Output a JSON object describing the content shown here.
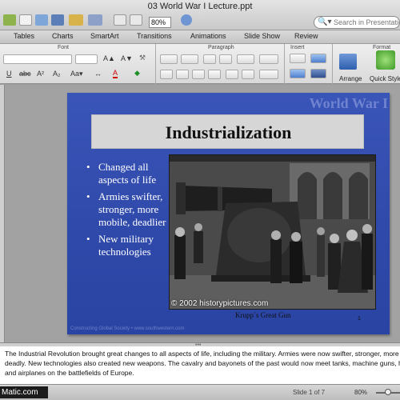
{
  "window": {
    "title": "03 World War I Lecture.ppt"
  },
  "toolbar": {
    "zoom": "80%",
    "search_placeholder": "Search in Presentation"
  },
  "ribbon": {
    "tabs": [
      {
        "label": "Tables"
      },
      {
        "label": "Charts"
      },
      {
        "label": "SmartArt"
      },
      {
        "label": "Transitions"
      },
      {
        "label": "Animations"
      },
      {
        "label": "Slide Show"
      },
      {
        "label": "Review"
      }
    ],
    "groups": {
      "font": "Font",
      "paragraph": "Paragraph",
      "insert": "Insert",
      "format": "Format"
    },
    "arrange_label": "Arrange",
    "quick_styles_label": "Quick Styles"
  },
  "slide": {
    "header": "World War I",
    "title": "Industrialization",
    "bullets": [
      "Changed all aspects of life",
      "Armies swifter, stronger, more mobile, deadlier",
      "New military technologies"
    ],
    "picture_caption": "© 2002 historypictures.com",
    "krupp_caption": "Krupp´s Great Gun",
    "slide_number": "1",
    "footer": "Constructing Global Society • www.southwestern.com"
  },
  "notes": {
    "lines": [
      "The Industrial Revolution brought great changes to all aspects of life, including the military. Armies were now swifter, stronger, more m",
      "deadly. New technologies also created new weapons. The cavalry and bayonets of the past would now meet tanks, machine guns, ho",
      "and airplanes on the battlefields of Europe."
    ]
  },
  "statusbar": {
    "watermark": "Matic.com",
    "slide_count": "Slide 1 of 7",
    "zoom": "80%"
  },
  "colors": {
    "slide_blue": "#3a55b8",
    "title_box_gray": "#d6d6d6",
    "header_text": "#6f83cf"
  }
}
